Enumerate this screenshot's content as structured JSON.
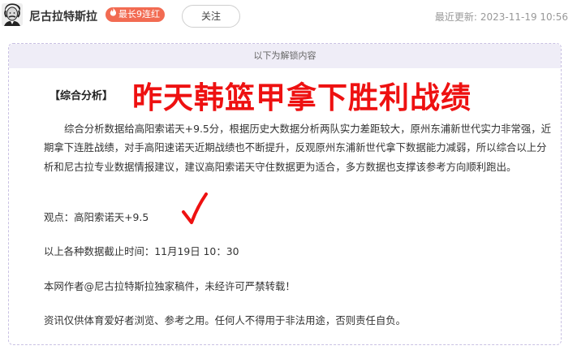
{
  "header": {
    "author_name": "尼古拉特斯拉",
    "streak_badge": "最长9连红",
    "follow_label": "关注",
    "updated_label": "最近更新:",
    "updated_time": "2023-11-19 10:56"
  },
  "content": {
    "unlock_banner": "以下为解锁内容",
    "section_title": "【综合分析】",
    "headline": "昨天韩篮甲拿下胜利战绩",
    "analysis": "综合分析数据给高阳索诺天+9.5分，根据历史大数据分析两队实力差距较大，原州东浦新世代实力非常强，近期拿下连胜战绩，对手高阳速诺天近期战绩也不断提升，反观原州东浦新世代拿下数据能力减弱，所以综合以上分析和尼古拉专业数据情报建议，建议高阳索诺天守住数据更为适合，多方数据也支撑该参考方向顺利跑出。",
    "viewpoint": "观点：高阳索诺天+9.5",
    "cutoff": "以上各种数据截止时间：11月19日 10：30",
    "copyright": "本网作者@尼古拉特斯拉独家稿件，未经许可严禁转载！",
    "disclaimer": "资讯仅供体育爱好者浏览、参考之用。任何人不得用于非法用途，否则责任自负。"
  },
  "icons": {
    "avatar": "portrait-avatar-icon",
    "flame": "flame-icon",
    "check": "red-check-icon"
  },
  "colors": {
    "headline": "#ee1111",
    "badge": "#f26b52",
    "banner_bg": "#efedf7",
    "border": "#c9c1e3"
  }
}
